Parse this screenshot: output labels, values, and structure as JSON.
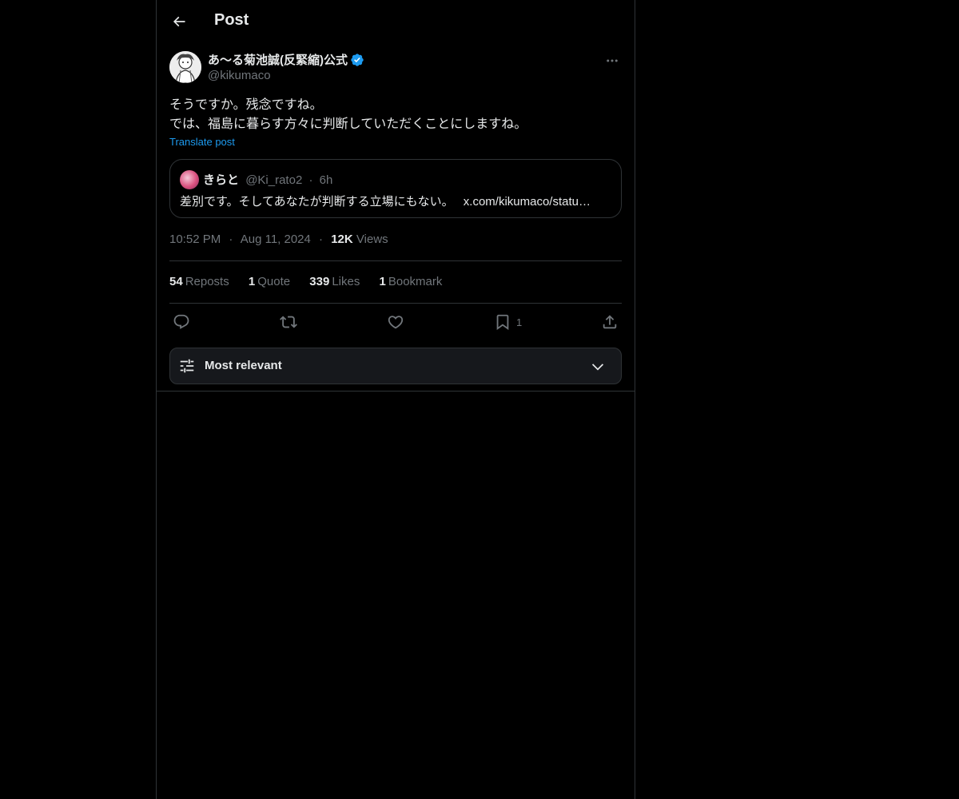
{
  "header": {
    "title": "Post",
    "back_icon": "arrow-left-icon"
  },
  "post": {
    "author_name": "あ〜る菊池誠(反緊縮)公式",
    "author_handle": "@kikumaco",
    "verified": true,
    "text_lines": [
      "そうですか。残念ですね。",
      "では、福島に暮らす方々に判断していただくことにしますね。"
    ],
    "translate_label": "Translate post",
    "quote": {
      "name": "きらと",
      "handle": "@Ki_rato2",
      "time": "6h",
      "text": "差別です。そしてあなたが判断する立場にもない。",
      "link": "x.com/kikumaco/statu…"
    },
    "time": "10:52 PM",
    "date": "Aug 11, 2024",
    "views_count": "12K",
    "views_label": "Views",
    "stats": {
      "reposts_count": "54",
      "reposts_label": "Reposts",
      "quotes_count": "1",
      "quotes_label": "Quote",
      "likes_count": "339",
      "likes_label": "Likes",
      "bookmarks_count": "1",
      "bookmarks_label": "Bookmark"
    },
    "actions": {
      "reply_icon": "reply-icon",
      "repost_icon": "repost-icon",
      "like_icon": "heart-icon",
      "bookmark_icon": "bookmark-icon",
      "bookmark_count": "1",
      "share_icon": "share-icon"
    }
  },
  "replies_sort": {
    "label": "Most relevant",
    "icon": "sliders-icon",
    "chevron": "chevron-down-icon"
  },
  "colors": {
    "background": "#000000",
    "text": "#e7e9ea",
    "secondary_text": "#71767b",
    "border": "#2f3336",
    "link": "#1d9bf0",
    "verified": "#1d9bf0"
  }
}
